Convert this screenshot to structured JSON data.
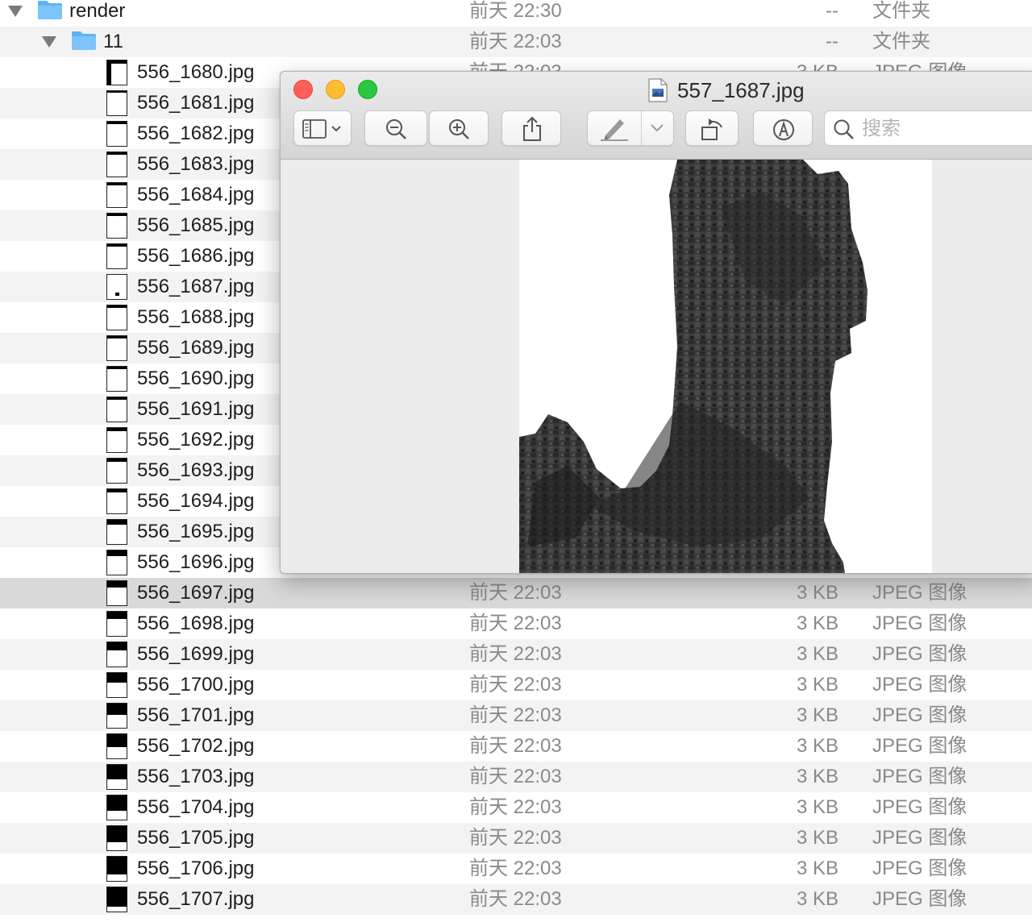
{
  "finder": {
    "rows": [
      {
        "type": "folder",
        "name": "render",
        "date": "前天 22:30",
        "size": "--",
        "kind": "文件夹"
      },
      {
        "type": "folder",
        "name": "11",
        "date": "前天 22:03",
        "size": "--",
        "kind": "文件夹"
      },
      {
        "type": "file",
        "name": "556_1680.jpg",
        "date": "前天 22:03",
        "size": "3 KB",
        "kind": "JPEG 图像"
      },
      {
        "type": "file",
        "name": "556_1681.jpg",
        "date": "",
        "size": "",
        "kind": ""
      },
      {
        "type": "file",
        "name": "556_1682.jpg",
        "date": "",
        "size": "",
        "kind": ""
      },
      {
        "type": "file",
        "name": "556_1683.jpg",
        "date": "",
        "size": "",
        "kind": ""
      },
      {
        "type": "file",
        "name": "556_1684.jpg",
        "date": "",
        "size": "",
        "kind": ""
      },
      {
        "type": "file",
        "name": "556_1685.jpg",
        "date": "",
        "size": "",
        "kind": ""
      },
      {
        "type": "file",
        "name": "556_1686.jpg",
        "date": "",
        "size": "",
        "kind": ""
      },
      {
        "type": "file",
        "name": "556_1687.jpg",
        "date": "",
        "size": "",
        "kind": ""
      },
      {
        "type": "file",
        "name": "556_1688.jpg",
        "date": "",
        "size": "",
        "kind": ""
      },
      {
        "type": "file",
        "name": "556_1689.jpg",
        "date": "",
        "size": "",
        "kind": ""
      },
      {
        "type": "file",
        "name": "556_1690.jpg",
        "date": "",
        "size": "",
        "kind": ""
      },
      {
        "type": "file",
        "name": "556_1691.jpg",
        "date": "",
        "size": "",
        "kind": ""
      },
      {
        "type": "file",
        "name": "556_1692.jpg",
        "date": "",
        "size": "",
        "kind": ""
      },
      {
        "type": "file",
        "name": "556_1693.jpg",
        "date": "",
        "size": "",
        "kind": ""
      },
      {
        "type": "file",
        "name": "556_1694.jpg",
        "date": "",
        "size": "",
        "kind": ""
      },
      {
        "type": "file",
        "name": "556_1695.jpg",
        "date": "",
        "size": "",
        "kind": ""
      },
      {
        "type": "file",
        "name": "556_1696.jpg",
        "date": "",
        "size": "",
        "kind": ""
      },
      {
        "type": "file",
        "name": "556_1697.jpg",
        "date": "前天 22:03",
        "size": "3 KB",
        "kind": "JPEG 图像",
        "selected": true
      },
      {
        "type": "file",
        "name": "556_1698.jpg",
        "date": "前天 22:03",
        "size": "3 KB",
        "kind": "JPEG 图像"
      },
      {
        "type": "file",
        "name": "556_1699.jpg",
        "date": "前天 22:03",
        "size": "3 KB",
        "kind": "JPEG 图像"
      },
      {
        "type": "file",
        "name": "556_1700.jpg",
        "date": "前天 22:03",
        "size": "3 KB",
        "kind": "JPEG 图像"
      },
      {
        "type": "file",
        "name": "556_1701.jpg",
        "date": "前天 22:03",
        "size": "3 KB",
        "kind": "JPEG 图像"
      },
      {
        "type": "file",
        "name": "556_1702.jpg",
        "date": "前天 22:03",
        "size": "3 KB",
        "kind": "JPEG 图像"
      },
      {
        "type": "file",
        "name": "556_1703.jpg",
        "date": "前天 22:03",
        "size": "3 KB",
        "kind": "JPEG 图像"
      },
      {
        "type": "file",
        "name": "556_1704.jpg",
        "date": "前天 22:03",
        "size": "3 KB",
        "kind": "JPEG 图像"
      },
      {
        "type": "file",
        "name": "556_1705.jpg",
        "date": "前天 22:03",
        "size": "3 KB",
        "kind": "JPEG 图像"
      },
      {
        "type": "file",
        "name": "556_1706.jpg",
        "date": "前天 22:03",
        "size": "3 KB",
        "kind": "JPEG 图像"
      },
      {
        "type": "file",
        "name": "556_1707.jpg",
        "date": "前天 22:03",
        "size": "3 KB",
        "kind": "JPEG 图像"
      }
    ]
  },
  "preview": {
    "title": "557_1687.jpg",
    "search_placeholder": "搜索",
    "toolbar_icons": [
      "sidebar-toggle-icon",
      "zoom-out-icon",
      "zoom-in-icon",
      "share-icon",
      "markup-pen-icon",
      "rotate-icon",
      "annotate-icon",
      "search-icon"
    ]
  },
  "colors": {
    "close": "#fe5f57",
    "minimize": "#febc2e",
    "maximize": "#28c840",
    "folder": "#5cb3f5",
    "terrain": "#3a3a3a"
  }
}
